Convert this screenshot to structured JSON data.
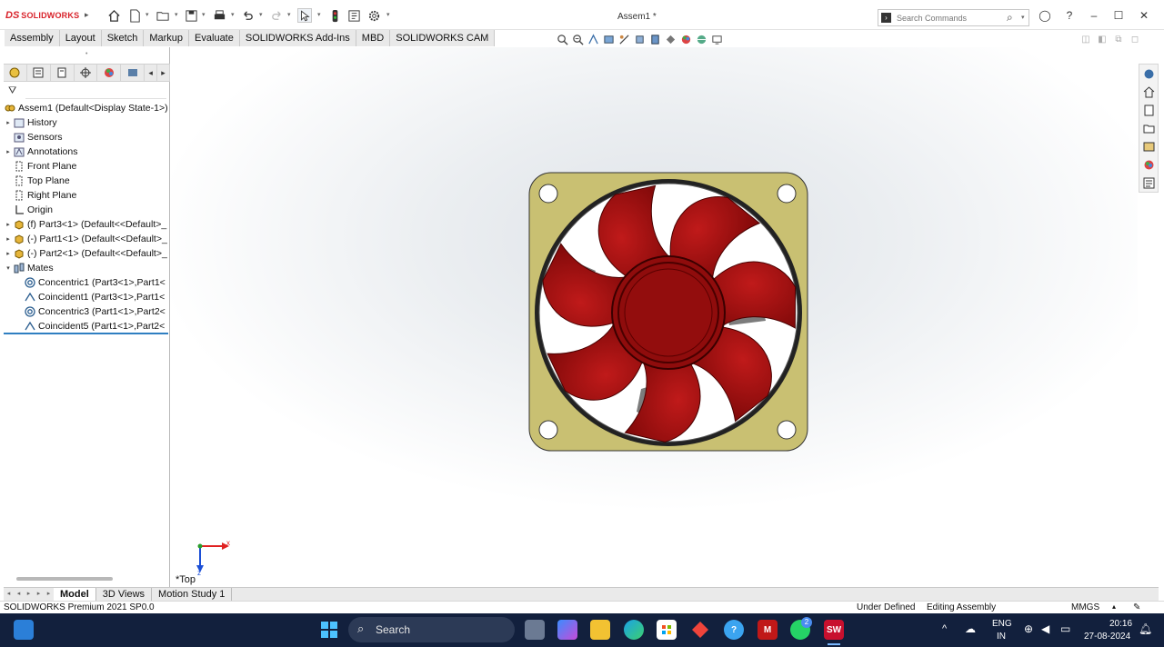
{
  "app": {
    "brand_prefix": "DS",
    "brand": "SOLIDWORKS",
    "document_title": "Assem1 *"
  },
  "search": {
    "placeholder": "Search Commands"
  },
  "command_tabs": [
    "Assembly",
    "Layout",
    "Sketch",
    "Markup",
    "Evaluate",
    "SOLIDWORKS Add-Ins",
    "MBD",
    "SOLIDWORKS CAM"
  ],
  "feature_tree": {
    "root": "Assem1  (Default<Display State-1>)",
    "items": [
      {
        "label": "History",
        "icon": "history-folder-icon",
        "expand": "▸"
      },
      {
        "label": "Sensors",
        "icon": "sensors-icon",
        "expand": ""
      },
      {
        "label": "Annotations",
        "icon": "annotations-icon",
        "expand": "▸"
      },
      {
        "label": "Front Plane",
        "icon": "plane-icon",
        "expand": ""
      },
      {
        "label": "Top Plane",
        "icon": "plane-icon",
        "expand": ""
      },
      {
        "label": "Right Plane",
        "icon": "plane-icon",
        "expand": ""
      },
      {
        "label": "Origin",
        "icon": "origin-icon",
        "expand": ""
      },
      {
        "label": "(f) Part3<1> (Default<<Default>_",
        "icon": "part-icon",
        "expand": "▸"
      },
      {
        "label": "(-) Part1<1> (Default<<Default>_",
        "icon": "part-icon",
        "expand": "▸"
      },
      {
        "label": "(-) Part2<1> (Default<<Default>_",
        "icon": "part-icon",
        "expand": "▸"
      },
      {
        "label": "Mates",
        "icon": "mates-folder-icon",
        "expand": "▾"
      }
    ],
    "mates": [
      {
        "label": "Concentric1 (Part3<1>,Part1<",
        "icon": "concentric-mate-icon"
      },
      {
        "label": "Coincident1 (Part3<1>,Part1<",
        "icon": "coincident-mate-icon"
      },
      {
        "label": "Concentric3 (Part1<1>,Part2<",
        "icon": "concentric-mate-icon"
      },
      {
        "label": "Coincident5 (Part1<1>,Part2<",
        "icon": "coincident-mate-icon"
      }
    ]
  },
  "viewport": {
    "view_label": "*Top",
    "triad": {
      "x_label": "x",
      "z_label": "z"
    },
    "colors": {
      "fan_blade": "#9e0f0f",
      "fan_frame": "#c9c072",
      "triad_x": "#e02020",
      "triad_z": "#1c4fd6"
    }
  },
  "bottom_tabs": [
    "Model",
    "3D Views",
    "Motion Study 1"
  ],
  "status": {
    "product": "SOLIDWORKS Premium 2021 SP0.0",
    "definition": "Under Defined",
    "mode": "Editing Assembly",
    "units": "MMGS"
  },
  "taskbar": {
    "search_label": "Search",
    "language": "ENG",
    "region": "IN",
    "time": "20:16",
    "date": "27-08-2024",
    "badge_count": "2"
  }
}
